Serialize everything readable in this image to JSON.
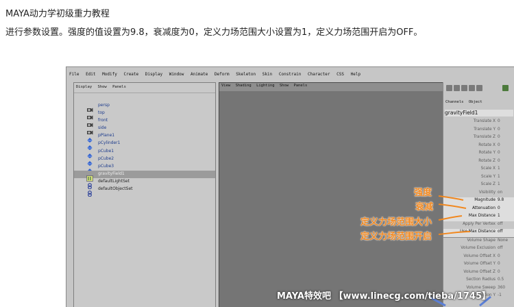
{
  "article": {
    "heading": "MAYA动力学初级重力教程",
    "description": "进行参数设置。强度的值设置为9.8，衰减度为0，定义力场范围大小设置为1，定义力场范围开启为OFF。"
  },
  "menubar": [
    "File",
    "Edit",
    "Modify",
    "Create",
    "Display",
    "Window",
    "Animate",
    "Deform",
    "Skeleton",
    "Skin",
    "Constrain",
    "Character",
    "CSS",
    "Help"
  ],
  "outliner": {
    "menus": [
      "Display",
      "Show",
      "Panels"
    ],
    "items": [
      {
        "label": "persp",
        "icon": "camera-icon"
      },
      {
        "label": "top",
        "icon": "camera-icon"
      },
      {
        "label": "front",
        "icon": "camera-icon"
      },
      {
        "label": "side",
        "icon": "camera-icon"
      },
      {
        "label": "pPlane1",
        "icon": "mesh-icon"
      },
      {
        "label": "pCylinder1",
        "icon": "mesh-icon"
      },
      {
        "label": "pCube1",
        "icon": "mesh-icon"
      },
      {
        "label": "pCube2",
        "icon": "mesh-icon"
      },
      {
        "label": "pCube3",
        "icon": "mesh-icon"
      },
      {
        "label": "gravityField1",
        "icon": "field-icon"
      },
      {
        "label": "defaultLightSet",
        "icon": "set-icon"
      },
      {
        "label": "defaultObjectSet",
        "icon": "set-icon"
      }
    ],
    "selected_index": 9
  },
  "viewport": {
    "menus": [
      "View",
      "Shading",
      "Lighting",
      "Show",
      "Panels"
    ]
  },
  "channel_box": {
    "tabs": [
      "Channels",
      "Object"
    ],
    "object_name": "gravityField1",
    "attributes": [
      {
        "name": "Translate X",
        "value": "0"
      },
      {
        "name": "Translate Y",
        "value": "0"
      },
      {
        "name": "Translate Z",
        "value": "0"
      },
      {
        "name": "Rotate X",
        "value": "0"
      },
      {
        "name": "Rotate Y",
        "value": "0"
      },
      {
        "name": "Rotate Z",
        "value": "0"
      },
      {
        "name": "Scale X",
        "value": "1"
      },
      {
        "name": "Scale Y",
        "value": "1"
      },
      {
        "name": "Scale Z",
        "value": "1"
      },
      {
        "name": "Visibility",
        "value": "on"
      },
      {
        "name": "Magnitude",
        "value": "9.8"
      },
      {
        "name": "Attenuation",
        "value": "0"
      },
      {
        "name": "Max Distance",
        "value": "1"
      },
      {
        "name": "Apply Per Vertex",
        "value": "off"
      },
      {
        "name": "Use Max Distance",
        "value": "off"
      },
      {
        "name": "Volume Shape",
        "value": "None"
      },
      {
        "name": "Volume Exclusion",
        "value": "off"
      },
      {
        "name": "Volume Offset X",
        "value": "0"
      },
      {
        "name": "Volume Offset Y",
        "value": "0"
      },
      {
        "name": "Volume Offset Z",
        "value": "0"
      },
      {
        "name": "Section Radius",
        "value": "0.5"
      },
      {
        "name": "Volume Sweep",
        "value": "360"
      },
      {
        "name": "Direction Y",
        "value": "-1"
      }
    ]
  },
  "annotations": {
    "magnitude": "强度",
    "attenuation": "衰减",
    "max_distance": "定义力场范围大小",
    "use_max_distance": "定义力场范围开启"
  },
  "watermark": "MAYA特效吧 【www.linecg.com/tieba/1745】",
  "colors": {
    "annotation": "#f1881f",
    "selected_row": "#9b9b9b",
    "viewport_bg": "#757575"
  }
}
